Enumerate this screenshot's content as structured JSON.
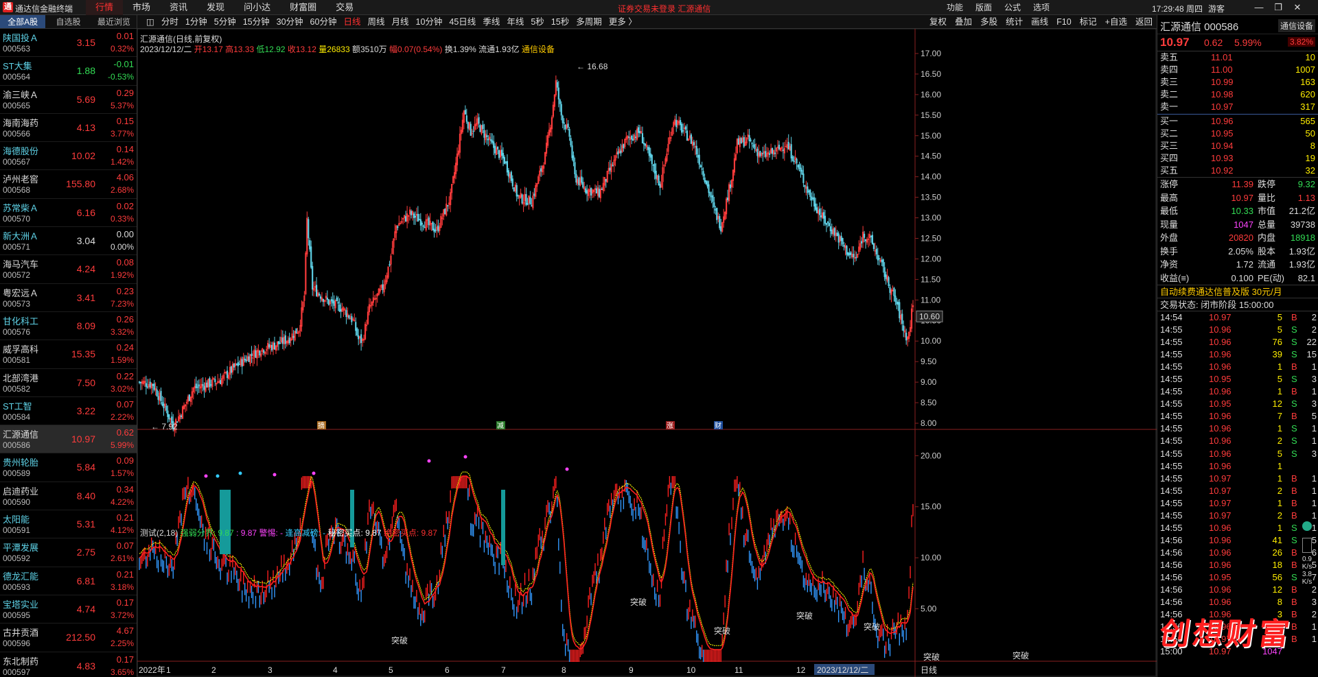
{
  "app": {
    "title": "通达信金融终端",
    "logo": "通"
  },
  "menu": [
    "行情",
    "市场",
    "资讯",
    "发现",
    "问小达",
    "财富圈",
    "交易"
  ],
  "menu_active": 0,
  "notice": "证券交易未登录  汇源通信",
  "right_menu": [
    "功能",
    "版面",
    "公式",
    "选项"
  ],
  "clock": "17:29:48 周四",
  "user": "游客",
  "left_tabs": [
    "全部A股",
    "自选股",
    "最近浏览"
  ],
  "stocks": [
    {
      "name": "陕国投Ａ",
      "code": "000563",
      "price": "3.15",
      "chg": "0.01",
      "pct": "0.32%",
      "dir": "up",
      "cyan": true
    },
    {
      "name": "ST大集",
      "code": "000564",
      "price": "1.88",
      "chg": "-0.01",
      "pct": "-0.53%",
      "dir": "dn",
      "cyan": true
    },
    {
      "name": "渝三峡Ａ",
      "code": "000565",
      "price": "5.69",
      "chg": "0.29",
      "pct": "5.37%",
      "dir": "up",
      "cyan": false
    },
    {
      "name": "海南海药",
      "code": "000566",
      "price": "4.13",
      "chg": "0.15",
      "pct": "3.77%",
      "dir": "up",
      "cyan": false
    },
    {
      "name": "海德股份",
      "code": "000567",
      "price": "10.02",
      "chg": "0.14",
      "pct": "1.42%",
      "dir": "up",
      "cyan": true
    },
    {
      "name": "泸州老窖",
      "code": "000568",
      "price": "155.80",
      "chg": "4.06",
      "pct": "2.68%",
      "dir": "up",
      "cyan": false
    },
    {
      "name": "苏常柴Ａ",
      "code": "000570",
      "price": "6.16",
      "chg": "0.02",
      "pct": "0.33%",
      "dir": "up",
      "cyan": true
    },
    {
      "name": "新大洲Ａ",
      "code": "000571",
      "price": "3.04",
      "chg": "0.00",
      "pct": "0.00%",
      "dir": "flat",
      "cyan": true
    },
    {
      "name": "海马汽车",
      "code": "000572",
      "price": "4.24",
      "chg": "0.08",
      "pct": "1.92%",
      "dir": "up",
      "cyan": false
    },
    {
      "name": "粤宏远Ａ",
      "code": "000573",
      "price": "3.41",
      "chg": "0.23",
      "pct": "7.23%",
      "dir": "up",
      "cyan": false
    },
    {
      "name": "甘化科工",
      "code": "000576",
      "price": "8.09",
      "chg": "0.26",
      "pct": "3.32%",
      "dir": "up",
      "cyan": true
    },
    {
      "name": "威孚高科",
      "code": "000581",
      "price": "15.35",
      "chg": "0.24",
      "pct": "1.59%",
      "dir": "up",
      "cyan": false
    },
    {
      "name": "北部湾港",
      "code": "000582",
      "price": "7.50",
      "chg": "0.22",
      "pct": "3.02%",
      "dir": "up",
      "cyan": false
    },
    {
      "name": "ST工智",
      "code": "000584",
      "price": "3.22",
      "chg": "0.07",
      "pct": "2.22%",
      "dir": "up",
      "cyan": true
    },
    {
      "name": "汇源通信",
      "code": "000586",
      "price": "10.97",
      "chg": "0.62",
      "pct": "5.99%",
      "dir": "up",
      "cyan": false,
      "sel": true
    },
    {
      "name": "贵州轮胎",
      "code": "000589",
      "price": "5.84",
      "chg": "0.09",
      "pct": "1.57%",
      "dir": "up",
      "cyan": true
    },
    {
      "name": "启迪药业",
      "code": "000590",
      "price": "8.40",
      "chg": "0.34",
      "pct": "4.22%",
      "dir": "up",
      "cyan": false
    },
    {
      "name": "太阳能",
      "code": "000591",
      "price": "5.31",
      "chg": "0.21",
      "pct": "4.12%",
      "dir": "up",
      "cyan": true
    },
    {
      "name": "平潭发展",
      "code": "000592",
      "price": "2.75",
      "chg": "0.07",
      "pct": "2.61%",
      "dir": "up",
      "cyan": true
    },
    {
      "name": "德龙汇能",
      "code": "000593",
      "price": "6.81",
      "chg": "0.21",
      "pct": "3.18%",
      "dir": "up",
      "cyan": true
    },
    {
      "name": "宝塔实业",
      "code": "000595",
      "price": "4.74",
      "chg": "0.17",
      "pct": "3.72%",
      "dir": "up",
      "cyan": true
    },
    {
      "name": "古井贡酒",
      "code": "000596",
      "price": "212.50",
      "chg": "4.67",
      "pct": "2.25%",
      "dir": "up",
      "cyan": false
    },
    {
      "name": "东北制药",
      "code": "000597",
      "price": "4.83",
      "chg": "0.17",
      "pct": "3.65%",
      "dir": "up",
      "cyan": false
    }
  ],
  "period_tabs": [
    "分时",
    "1分钟",
    "5分钟",
    "15分钟",
    "30分钟",
    "60分钟",
    "日线",
    "周线",
    "月线",
    "10分钟",
    "45日线",
    "季线",
    "年线",
    "5秒",
    "15秒",
    "多周期",
    "更多 〉"
  ],
  "period_active": 6,
  "chart_tools": [
    "复权",
    "叠加",
    "多股",
    "统计",
    "画线",
    "F10",
    "标记",
    "+自选",
    "返回"
  ],
  "chart_header": {
    "title": "汇源通信(日线,前复权)",
    "date": "2023/12/12/二",
    "open": "开13.17",
    "high": "高13.33",
    "low": "低12.92",
    "close": "收13.12",
    "vol": "量26833",
    "amount": "额3510万",
    "amp": "幅0.07(0.54%)",
    "turnover": "换1.39%",
    "float": "流通1.93亿",
    "sector": "通信设备"
  },
  "indicator_header": {
    "name": "测试(2,18)",
    "a": "强弱分界: 9.87",
    "b": ": 9.87",
    "c": "警惕: -",
    "d": "逢高减磅: -",
    "e": "秘密买点: 9.87",
    "f": "绝密买点: 9.87"
  },
  "colors": {
    "up": "#ff3c3c",
    "down": "#5fd3e8",
    "ma": "#e8e800",
    "signal": "#ff2020"
  },
  "chart_data": {
    "type": "candlestick",
    "y_axis_ticks": [
      "17.00",
      "16.50",
      "16.00",
      "15.50",
      "15.00",
      "14.50",
      "14.00",
      "13.50",
      "13.00",
      "12.50",
      "12.00",
      "11.50",
      "11.00",
      "10.50",
      "10.00",
      "9.50",
      "9.00",
      "8.50",
      "8.00"
    ],
    "ylim": [
      7.75,
      17.1
    ],
    "x_axis_ticks": [
      "2022年",
      "1",
      "2",
      "3",
      "4",
      "5",
      "6",
      "7",
      "8",
      "9",
      "10",
      "11",
      "12",
      "2023/12/12/二"
    ],
    "x_label": "日线",
    "price_label": "10.60",
    "max_label": "16.68",
    "min_label": "7.92",
    "events": [
      "摘",
      "减",
      "涨",
      "财"
    ],
    "indicator_y_ticks": [
      "20.00",
      "15.00",
      "10.00",
      "5.00"
    ],
    "indicator_ylim": [
      0,
      21.5
    ],
    "signal_labels": [
      "突破",
      "突破",
      "突破",
      "突破",
      "突破",
      "突破",
      "突破"
    ],
    "keypoints": [
      [
        0,
        9.0
      ],
      [
        10,
        8.95
      ],
      [
        20,
        8.3
      ],
      [
        25,
        7.95
      ],
      [
        30,
        8.2
      ],
      [
        40,
        8.85
      ],
      [
        50,
        8.95
      ],
      [
        60,
        9.05
      ],
      [
        70,
        9.35
      ],
      [
        80,
        9.6
      ],
      [
        90,
        9.8
      ],
      [
        100,
        9.9
      ],
      [
        110,
        10.05
      ],
      [
        118,
        10.3
      ],
      [
        122,
        11.1
      ],
      [
        124,
        12.95
      ],
      [
        128,
        11.3
      ],
      [
        140,
        10.95
      ],
      [
        150,
        10.8
      ],
      [
        158,
        10.5
      ],
      [
        162,
        10.05
      ],
      [
        165,
        10.0
      ],
      [
        170,
        10.8
      ],
      [
        180,
        11.3
      ],
      [
        185,
        11.9
      ],
      [
        190,
        12.8
      ],
      [
        200,
        13.1
      ],
      [
        210,
        12.9
      ],
      [
        220,
        12.7
      ],
      [
        230,
        13.5
      ],
      [
        235,
        14.5
      ],
      [
        240,
        15.6
      ],
      [
        245,
        15.1
      ],
      [
        250,
        15.3
      ],
      [
        260,
        14.8
      ],
      [
        270,
        14.4
      ],
      [
        280,
        13.5
      ],
      [
        290,
        13.4
      ],
      [
        300,
        14.5
      ],
      [
        305,
        15.5
      ],
      [
        308,
        16.3
      ],
      [
        312,
        15.5
      ],
      [
        318,
        15.0
      ],
      [
        322,
        14.0
      ],
      [
        330,
        13.7
      ],
      [
        340,
        13.6
      ],
      [
        350,
        14.3
      ],
      [
        360,
        14.9
      ],
      [
        370,
        15.1
      ],
      [
        380,
        14.2
      ],
      [
        385,
        13.8
      ],
      [
        390,
        14.6
      ],
      [
        395,
        15.4
      ],
      [
        400,
        15.2
      ],
      [
        410,
        14.8
      ],
      [
        418,
        14.0
      ],
      [
        425,
        13.2
      ],
      [
        430,
        12.8
      ],
      [
        438,
        14.0
      ],
      [
        442,
        14.8
      ],
      [
        450,
        14.9
      ],
      [
        460,
        14.5
      ],
      [
        470,
        14.6
      ],
      [
        478,
        14.8
      ],
      [
        485,
        14.4
      ],
      [
        495,
        13.6
      ],
      [
        505,
        13.0
      ],
      [
        515,
        12.6
      ],
      [
        525,
        12.1
      ],
      [
        530,
        12.0
      ],
      [
        535,
        12.6
      ],
      [
        540,
        12.5
      ],
      [
        548,
        11.9
      ],
      [
        555,
        11.3
      ],
      [
        560,
        10.9
      ],
      [
        565,
        10.3
      ],
      [
        568,
        10.05
      ],
      [
        570,
        10.4
      ],
      [
        572,
        10.97
      ]
    ]
  }
}
